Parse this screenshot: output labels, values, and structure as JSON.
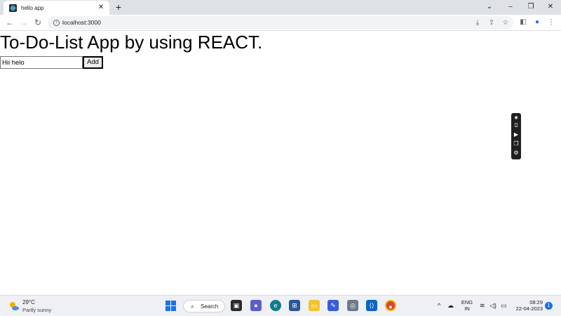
{
  "browser": {
    "tab_title": "hello app",
    "tab_close": "✕",
    "new_tab": "+",
    "url": "localhost:3000",
    "window_controls": {
      "collapse": "⌄",
      "minimize": "–",
      "restore": "❐",
      "close": "✕"
    }
  },
  "app": {
    "heading": "To-Do-List App by using REACT.",
    "input_value": "Hii helo",
    "add_button": "Add"
  },
  "taskbar": {
    "weather_temp": "29°C",
    "weather_desc": "Partly sunny",
    "search_label": "Search",
    "lang_line1": "ENG",
    "lang_line2": "IN",
    "time": "08:29",
    "date": "22-04-2023",
    "notification_count": "1"
  },
  "colors": {
    "tabstrip": "#dee1e6",
    "accent": "#1a73e8",
    "float_bar": "#1f1f1f"
  }
}
